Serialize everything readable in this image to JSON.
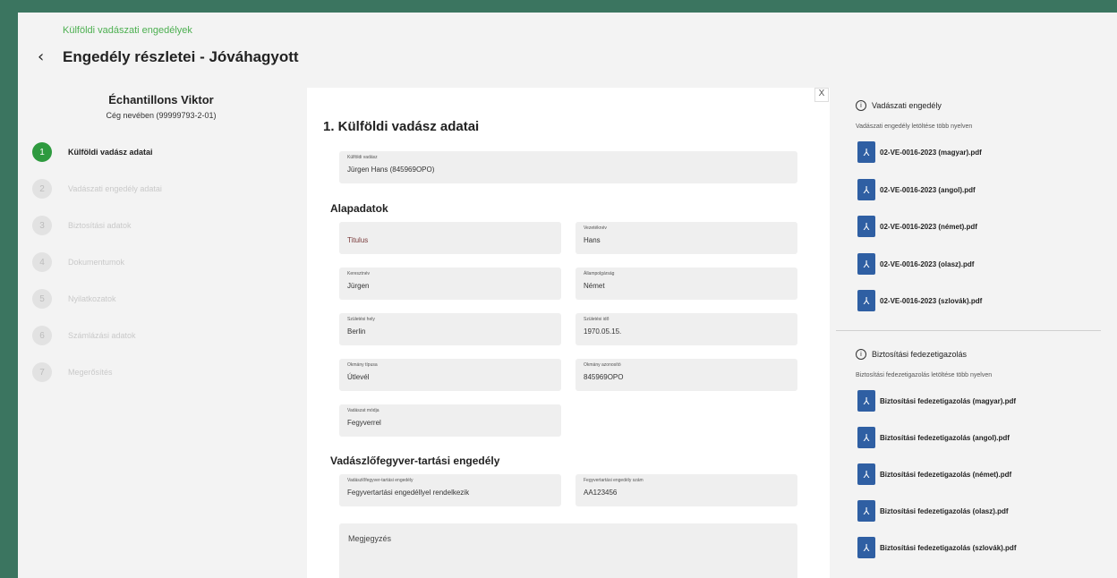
{
  "breadcrumb": "Külföldi vadászati engedélyek",
  "title": "Engedély részletei - Jóváhagyott",
  "user": {
    "name": "Échantillons Viktor",
    "company": "Cég nevében (99999793-2-01)"
  },
  "steps": [
    {
      "num": "1",
      "label": "Külföldi vadász adatai"
    },
    {
      "num": "2",
      "label": "Vadászati engedély adatai"
    },
    {
      "num": "3",
      "label": "Biztosítási adatok"
    },
    {
      "num": "4",
      "label": "Dokumentumok"
    },
    {
      "num": "5",
      "label": "Nyilatkozatok"
    },
    {
      "num": "6",
      "label": "Számlázási adatok"
    },
    {
      "num": "7",
      "label": "Megerősítés"
    }
  ],
  "form": {
    "close": "X",
    "section_title": "1. Külföldi vadász adatai",
    "hunter": {
      "caption": "Külföldi vadász",
      "value": "Jürgen Hans (845969OPO)"
    },
    "basic_title": "Alapadatok",
    "titulus": {
      "caption": "",
      "value": "Titulus"
    },
    "vezeteknev": {
      "caption": "Vezetéknév",
      "value": "Hans"
    },
    "keresztnev": {
      "caption": "Keresztnév",
      "value": "Jürgen"
    },
    "allampolgarsag": {
      "caption": "Állampolgárság",
      "value": "Német"
    },
    "szuletesi_hely": {
      "caption": "Születési hely",
      "value": "Berlin"
    },
    "szuletesi_ido": {
      "caption": "Születési idő",
      "value": "1970.05.15."
    },
    "okmany_tipusa": {
      "caption": "Okmány típusa",
      "value": "Útlevél"
    },
    "okmany_azonosito": {
      "caption": "Okmány azonosító",
      "value": "845969OPO"
    },
    "vadaszat_modja": {
      "caption": "Vadászat módja",
      "value": "Fegyverrel"
    },
    "weapon_title": "Vadászlőfegyver-tartási engedély",
    "weapon_permit": {
      "caption": "Vadászlőfegyver-tartási engedély",
      "value": "Fegyvertartási engedéllyel rendelkezik"
    },
    "weapon_number": {
      "caption": "Fegyvertartási engedély szám",
      "value": "AA123456"
    },
    "note_placeholder": "Megjegyzés"
  },
  "hunting_panel": {
    "title": "Vadászati engedély",
    "subtitle": "Vadászati engedély letöltése több nyelven",
    "files": [
      "02-VE-0016-2023 (magyar).pdf",
      "02-VE-0016-2023 (angol).pdf",
      "02-VE-0016-2023 (német).pdf",
      "02-VE-0016-2023 (olasz).pdf",
      "02-VE-0016-2023 (szlovák).pdf"
    ]
  },
  "insurance_panel": {
    "title": "Biztosítási fedezetigazolás",
    "subtitle": "Biztosítási fedezetigazolás letöltése több nyelven",
    "files": [
      "Biztosítási fedezetigazolás (magyar).pdf",
      "Biztosítási fedezetigazolás (angol).pdf",
      "Biztosítási fedezetigazolás (német).pdf",
      "Biztosítási fedezetigazolás (olasz).pdf",
      "Biztosítási fedezetigazolás (szlovák).pdf"
    ]
  },
  "colors": {
    "frame": "#3b7560",
    "active_step": "#2e9a3f",
    "breadcrumb": "#4caf50",
    "pdf": "#2f5fa3"
  },
  "icons": {
    "back": "chevron-left-icon",
    "info": "info-icon",
    "pdf": "pdf-icon",
    "close": "close-icon"
  }
}
